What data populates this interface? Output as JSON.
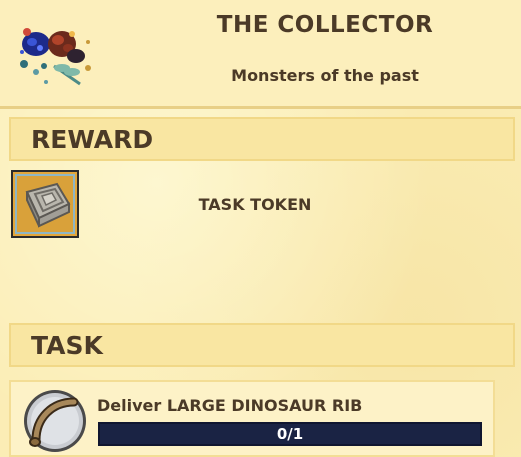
{
  "header": {
    "title": "THE COLLECTOR",
    "subtitle": "Monsters of the past",
    "art_icon": "fossil-collection-icon"
  },
  "reward": {
    "section_label": "REWARD",
    "item_name": "TASK TOKEN",
    "item_icon": "task-token-icon"
  },
  "task": {
    "section_label": "TASK",
    "description": "Deliver LARGE DINOSAUR RIB",
    "item_icon": "dinosaur-rib-icon",
    "progress_text": "0/1",
    "progress_fraction": 0
  },
  "colors": {
    "text": "#4b3a27",
    "panel_bg": "#fbedb5",
    "progress_bg": "#1a2344"
  }
}
